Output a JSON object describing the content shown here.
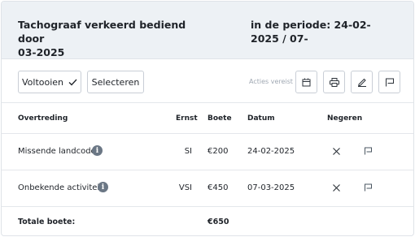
{
  "header": {
    "title": "Tachograaf verkeerd bediend door 03-2025",
    "title_line1": "Tachograaf verkeerd bediend door",
    "title_line2": "03-2025",
    "period": "in de periode: 24-02-2025 / 07-"
  },
  "toolbar": {
    "complete_label": "Voltooien",
    "select_label": "Selecteren",
    "actions_required": "Acties vereist",
    "icons": [
      "calendar-icon",
      "printer-icon",
      "edit-icon",
      "comment-flag-icon"
    ]
  },
  "table": {
    "columns": {
      "violation": "Overtreding",
      "severity": "Ernst",
      "fine": "Boete",
      "date": "Datum",
      "ignore": "Negeren"
    },
    "rows": [
      {
        "violation": "Missende landcode",
        "severity": "SI",
        "fine": "€200",
        "date": "24-02-2025"
      },
      {
        "violation": "Onbekende activiteit",
        "severity": "VSI",
        "fine": "€450",
        "date": "07-03-2025"
      }
    ],
    "total_label": "Totale boete:",
    "total_value": "€650"
  }
}
